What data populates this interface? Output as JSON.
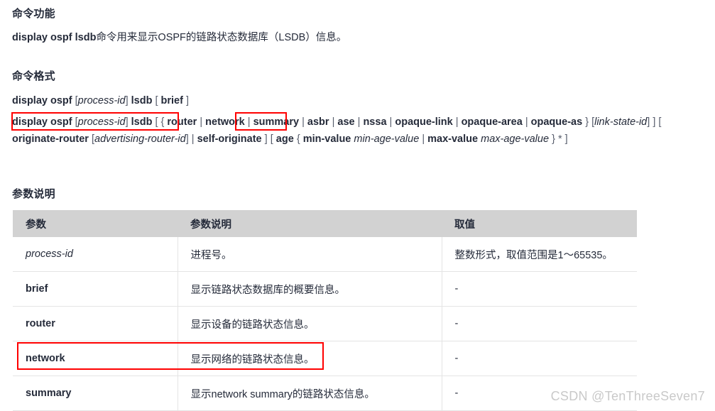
{
  "sections": {
    "function_heading": "命令功能",
    "format_heading": "命令格式",
    "params_heading": "参数说明"
  },
  "function_paragraph": {
    "command": "display ospf lsdb",
    "text": "命令用来显示OSPF的链路状态数据库（LSDB）信息。"
  },
  "command_format": {
    "simple": {
      "cmd": "display ospf",
      "open1": "[",
      "var1": "process-id",
      "close1": "]",
      "kw1": "lsdb",
      "open2": "[",
      "kw2": "brief",
      "close2": "]"
    },
    "full": {
      "cmd": "display ospf",
      "b1": "[",
      "var_process": "process-id",
      "b2": "]",
      "kw_lsdb": "lsdb",
      "b3": "[",
      "b4": "{",
      "kw_router": "router",
      "sep1": "|",
      "kw_network": "network",
      "sep2": "|",
      "kw_summary": "summary",
      "sep3": "|",
      "kw_asbr": "asbr",
      "sep4": "|",
      "kw_ase": "ase",
      "sep5": "|",
      "kw_nssa": "nssa",
      "sep6": "|",
      "kw_opaque_link": "opaque-link",
      "sep7": "|",
      "kw_opaque_area": "opaque-area",
      "sep8": "|",
      "kw_opaque_as": "opaque-as",
      "b5": "}",
      "b6": "[",
      "var_link_state": "link-state-id",
      "b7": "]",
      "b8": "]",
      "b9": "[",
      "kw_originate_router": "originate-router",
      "b10": "[",
      "var_adv_router": "advertising-router-id",
      "b11": "]",
      "sep9": "|",
      "kw_self_originate": "self-originate",
      "b12": "]",
      "b13": "[",
      "kw_age": "age",
      "b14": "{",
      "kw_min_value": "min-value",
      "var_min_age": "min-age-value",
      "sep10": "|",
      "kw_max_value": "max-value",
      "var_max_age": "max-age-value",
      "b15": "}",
      "star": "*",
      "b16": "]"
    }
  },
  "params_table": {
    "headers": [
      "参数",
      "参数说明",
      "取值"
    ],
    "rows": [
      {
        "param": "process-id",
        "italic": true,
        "desc": "进程号。",
        "value": "整数形式，取值范围是1～65535。"
      },
      {
        "param": "brief",
        "italic": false,
        "desc": "显示链路状态数据库的概要信息。",
        "value": "-"
      },
      {
        "param": "router",
        "italic": false,
        "desc": "显示设备的链路状态信息。",
        "value": "-"
      },
      {
        "param": "network",
        "italic": false,
        "desc": "显示网络的链路状态信息。",
        "value": "-"
      },
      {
        "param": "summary",
        "italic": false,
        "desc": "显示network summary的链路状态信息。",
        "value": "-"
      }
    ]
  },
  "annotations": {
    "highlight_color": "#ff0000",
    "boxes": [
      "display ospf [ process-id ] lsdb",
      "network",
      "network row"
    ]
  },
  "watermark": "CSDN @TenThreeSeven7"
}
